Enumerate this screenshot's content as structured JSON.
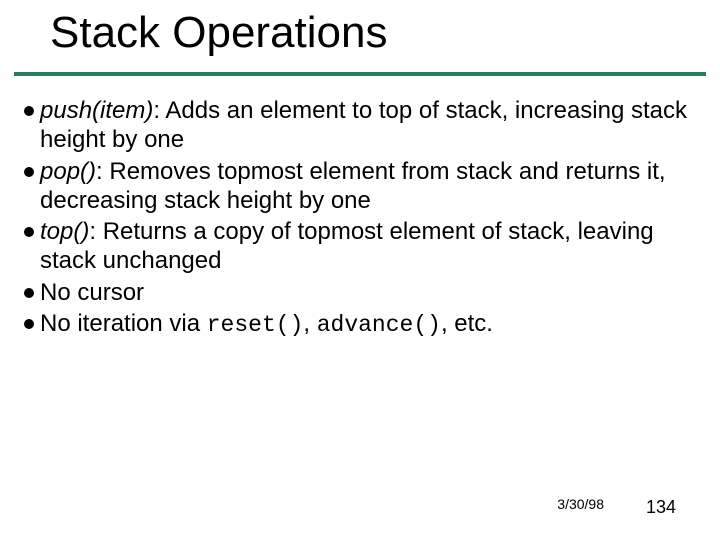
{
  "title": "Stack Operations",
  "bullets": {
    "b1": {
      "term": "push(item)",
      "rest": ": Adds an element to top of stack, increasing stack height by one"
    },
    "b2": {
      "term": "pop()",
      "rest": ": Removes topmost element from stack and returns it, decreasing stack height by one"
    },
    "b3": {
      "term": "top()",
      "rest": ": Returns a copy of topmost element of stack, leaving stack unchanged"
    },
    "b4": {
      "text": "No cursor"
    },
    "b5": {
      "pre": "No iteration via ",
      "code1": "reset()",
      "mid": ", ",
      "code2": "advance()",
      "post": ", etc."
    }
  },
  "footer": {
    "date": "3/30/98",
    "page": "134"
  }
}
